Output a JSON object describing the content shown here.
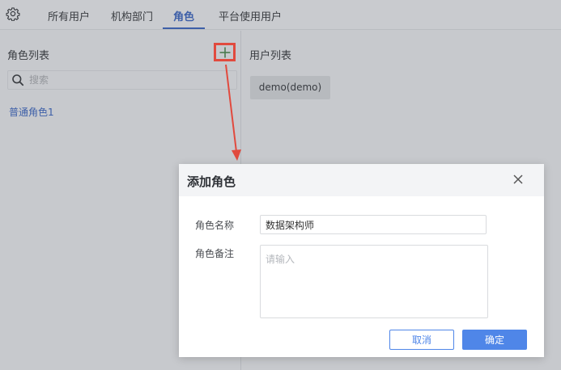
{
  "tabs": [
    {
      "label": "所有用户",
      "active": false
    },
    {
      "label": "机构部门",
      "active": false
    },
    {
      "label": "角色",
      "active": true
    },
    {
      "label": "平台使用用户",
      "active": false
    }
  ],
  "left_panel": {
    "title": "角色列表",
    "search_placeholder": "搜索",
    "roles": [
      "普通角色1"
    ]
  },
  "right_panel": {
    "title": "用户列表",
    "users": [
      "demo(demo)"
    ]
  },
  "dialog": {
    "title": "添加角色",
    "name_label": "角色名称",
    "name_value": "数据架构师",
    "remark_label": "角色备注",
    "remark_placeholder": "请输入",
    "cancel_label": "取消",
    "ok_label": "确定"
  },
  "colors": {
    "accent": "#4f86e8",
    "active_tab": "#3d5fa8",
    "highlight": "#e14a3e"
  }
}
